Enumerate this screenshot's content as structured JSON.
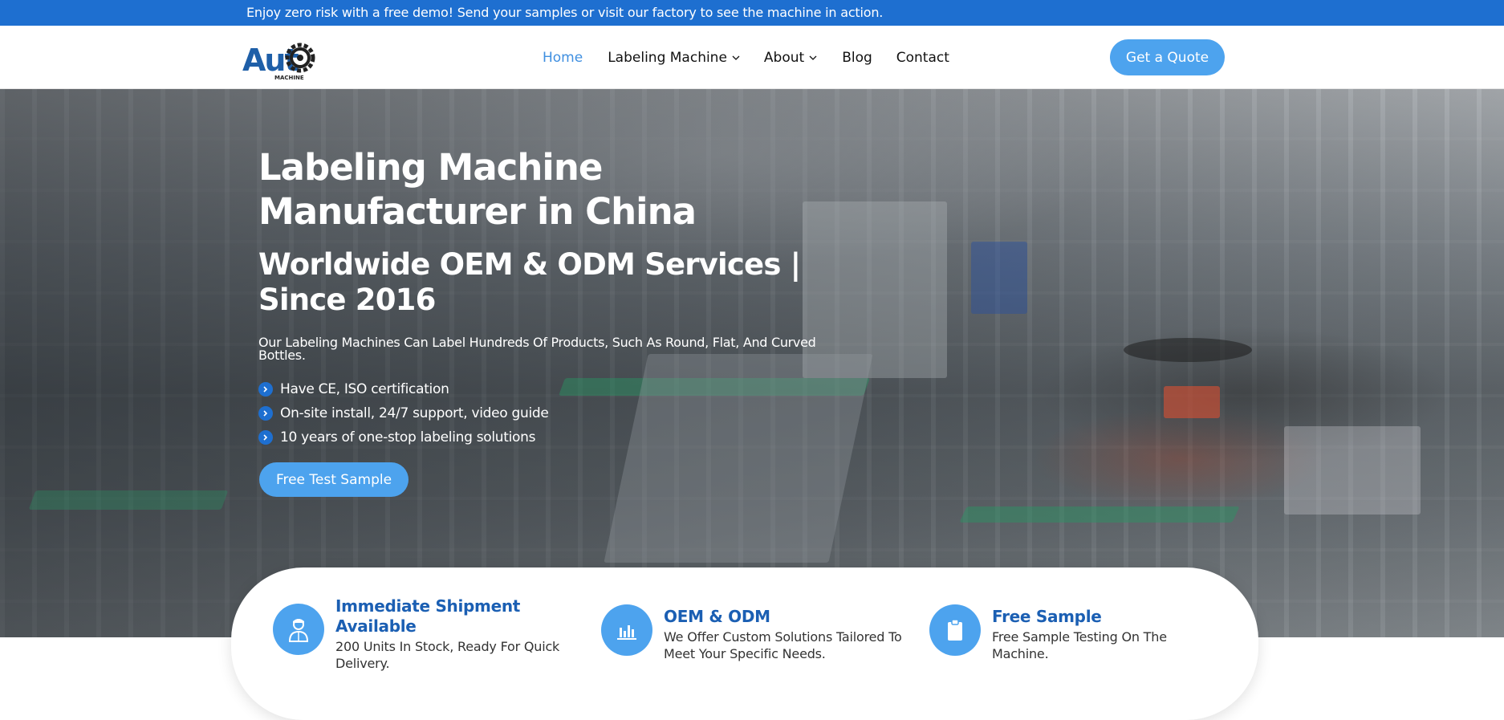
{
  "announcement": "Enjoy zero risk with a free demo! Send your samples or visit our factory to see the machine in action.",
  "logo": {
    "text": "Aut",
    "subtext": "MACHINE",
    "brand_color": "#1e5fa8"
  },
  "nav": {
    "items": [
      {
        "label": "Home",
        "active": true
      },
      {
        "label": "Labeling Machine",
        "dropdown": true
      },
      {
        "label": "About",
        "dropdown": true
      },
      {
        "label": "Blog"
      },
      {
        "label": "Contact"
      }
    ],
    "quote_button": "Get a Quote"
  },
  "hero": {
    "title": "Labeling Machine Manufacturer in China",
    "subtitle": "Worldwide OEM & ODM Services | Since 2016",
    "description": "Our Labeling Machines Can Label Hundreds Of Products, Such As Round, Flat, And Curved Bottles.",
    "features": [
      "Have CE, ISO certification",
      "On-site install, 24/7 support, video guide",
      "10 years of one-stop labeling solutions"
    ],
    "cta_button": "Free Test Sample"
  },
  "highlights": [
    {
      "icon": "worker-icon",
      "title": "Immediate Shipment Available",
      "description": "200 Units In Stock, Ready For Quick Delivery."
    },
    {
      "icon": "bar-chart-icon",
      "title": "OEM & ODM",
      "description": "We Offer Custom Solutions Tailored To Meet Your Specific Needs."
    },
    {
      "icon": "clipboard-icon",
      "title": "Free Sample",
      "description": "Free Sample Testing On The Machine."
    }
  ],
  "colors": {
    "topbar": "#1e6fd0",
    "accent": "#4da3ee",
    "active_nav": "#3f8fe0",
    "card_title": "#1b5fb3"
  }
}
